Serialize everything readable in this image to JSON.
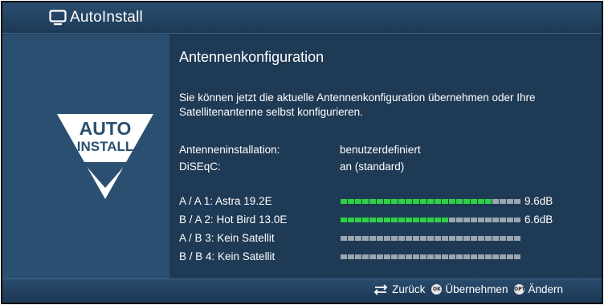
{
  "header": {
    "title": "AutoInstall",
    "icon": "tv-icon"
  },
  "logo": {
    "line1": "AUTO",
    "line2": "INSTALL"
  },
  "content": {
    "heading": "Antennenkonfiguration",
    "description": "Sie können jetzt die aktuelle Antennenkonfiguration übernehmen oder Ihre Satellitenantenne selbst konfigurieren.",
    "info": [
      {
        "label": "Antenneninstallation:",
        "value": "benutzerdefiniert"
      },
      {
        "label": "DiSEqC:",
        "value": "an (standard)"
      }
    ],
    "satellites": [
      {
        "label": "A / A  1:  Astra 19.2E",
        "level": 0.84,
        "db": "9.6dB"
      },
      {
        "label": "B / A  2:  Hot Bird 13.0E",
        "level": 0.6,
        "db": "6.6dB"
      },
      {
        "label": "A / B  3:  Kein Satellit",
        "level": 0,
        "db": ""
      },
      {
        "label": "B / B  4:  Kein Satellit",
        "level": 0,
        "db": ""
      }
    ]
  },
  "footer": {
    "back_label": "Zurück",
    "ok_key": "OK",
    "ok_label": "Übernehmen",
    "opt_key": "OPT",
    "opt_label": "Ändern"
  },
  "colors": {
    "signal": "#2ed145",
    "bar_empty": "#9aa6b1",
    "panel": "#2b4f71",
    "background": "#1f3a55"
  }
}
